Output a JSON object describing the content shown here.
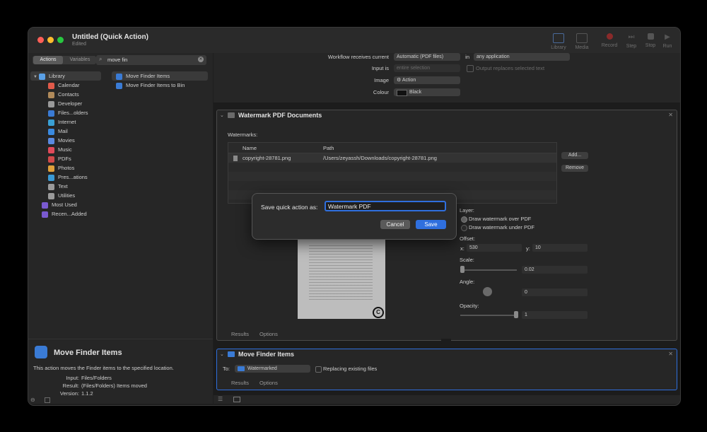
{
  "window": {
    "title": "Untitled (Quick Action)",
    "subtitle": "Edited"
  },
  "toolbar": {
    "library": "Library",
    "media": "Media",
    "record": "Record",
    "step": "Step",
    "stop": "Stop",
    "run": "Run"
  },
  "sidebar": {
    "tab_actions": "Actions",
    "tab_variables": "Variables",
    "search_value": "move fin",
    "library_items": [
      {
        "label": "Library",
        "color": "#5aa0e6"
      },
      {
        "label": "Calendar",
        "color": "#e05a4a"
      },
      {
        "label": "Contacts",
        "color": "#b08a5a"
      },
      {
        "label": "Developer",
        "color": "#9a9a9a"
      },
      {
        "label": "Files...olders",
        "color": "#3a7bd5"
      },
      {
        "label": "Internet",
        "color": "#3aa0d5"
      },
      {
        "label": "Mail",
        "color": "#3a8ae0"
      },
      {
        "label": "Movies",
        "color": "#5a8ae0"
      },
      {
        "label": "Music",
        "color": "#e04a5a"
      },
      {
        "label": "PDFs",
        "color": "#d04a4a"
      },
      {
        "label": "Photos",
        "color": "#e0a03a"
      },
      {
        "label": "Pres...ations",
        "color": "#3a9ad5"
      },
      {
        "label": "Text",
        "color": "#9a9a9a"
      },
      {
        "label": "Utilities",
        "color": "#9a9a9a"
      },
      {
        "label": "Most Used",
        "color": "#7a5ad0"
      },
      {
        "label": "Recen...Added",
        "color": "#7a5ad0"
      }
    ],
    "results": [
      {
        "label": "Move Finder Items"
      },
      {
        "label": "Move Finder Items to Bin"
      }
    ],
    "desc_title": "Move Finder Items",
    "desc_text": "This action moves the Finder items to the specified location.",
    "input_label": "Input:",
    "input_value": "Files/Folders",
    "result_label": "Result:",
    "result_value": "(Files/Folders) Items moved",
    "version_label": "Version:",
    "version_value": "1.1.2"
  },
  "workflow": {
    "receives_label": "Workflow receives current",
    "receives_value": "Automatic (PDF files)",
    "in_label": "in",
    "in_value": "any application",
    "input_is_label": "Input is",
    "input_is_value": "entire selection",
    "output_replaces": "Output replaces selected text",
    "image_label": "Image",
    "image_value": "⚙ Action",
    "colour_label": "Colour",
    "colour_value": "Black"
  },
  "watermark": {
    "title": "Watermark PDF Documents",
    "watermarks_label": "Watermarks:",
    "col_name": "Name",
    "col_path": "Path",
    "row_name": "copyright-28781.png",
    "row_path": "/Users/zeyassh/Downloads/copyright-28781.png",
    "add": "Add...",
    "remove": "Remove",
    "layer_label": "Layer:",
    "layer_over": "Draw watermark over PDF",
    "layer_under": "Draw watermark under PDF",
    "offset_label": "Offset:",
    "x_label": "x:",
    "x_value": "530",
    "y_label": "y:",
    "y_value": "10",
    "scale_label": "Scale:",
    "scale_value": "0.02",
    "angle_label": "Angle:",
    "angle_value": "0",
    "opacity_label": "Opacity:",
    "opacity_value": "1",
    "results": "Results",
    "options": "Options"
  },
  "move": {
    "title": "Move Finder Items",
    "to_label": "To:",
    "to_value": "Watermarked",
    "replacing": "Replacing existing files",
    "results": "Results",
    "options": "Options"
  },
  "dialog": {
    "label": "Save quick action as:",
    "value": "Watermark PDF",
    "cancel": "Cancel",
    "save": "Save"
  },
  "colors": {
    "accent": "#2f6fde",
    "dialog_border": "#2f6fde"
  }
}
